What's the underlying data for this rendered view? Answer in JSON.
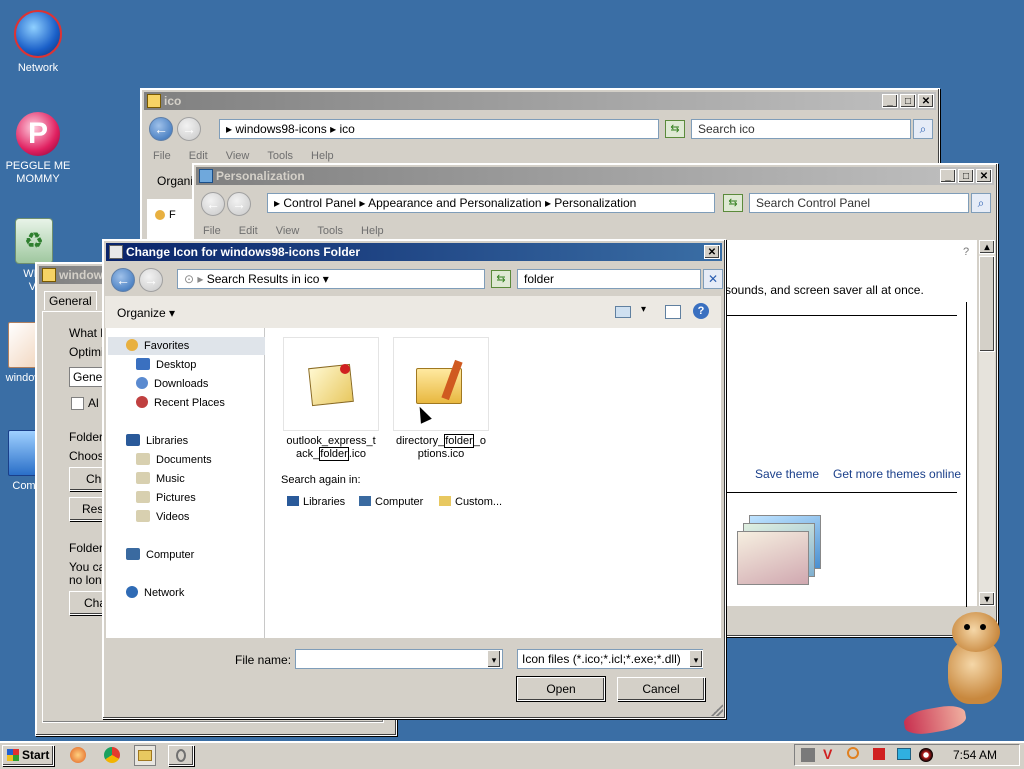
{
  "desktop": {
    "icons": [
      {
        "label": "Network"
      },
      {
        "label": "PEGGLE ME MOMMY"
      },
      {
        "label": "WIN"
      },
      {
        "label": "VI"
      },
      {
        "label": "window"
      },
      {
        "label": "Com"
      }
    ]
  },
  "ico_window": {
    "title": "ico",
    "breadcrumb": [
      "windows98-icons",
      "ico"
    ],
    "search_placeholder": "Search ico",
    "menu": [
      "File",
      "Edit",
      "View",
      "Tools",
      "Help"
    ],
    "organize_partial": "Organi",
    "partial_item": "F"
  },
  "properties_window": {
    "title": "window",
    "tab_general": "General",
    "text_what": "What k",
    "text_optimize": "Optimi",
    "combo_partial": "Gene",
    "check_partial": "Al",
    "group_folder1": "Folder",
    "text_choose": "Choos",
    "btn_ch": "Ch",
    "btn_res": "Res",
    "group_folder2": "Folder",
    "text_you": "You ca",
    "text_nolon": "no lon",
    "btn_cha": "Cha"
  },
  "personalization_window": {
    "title": "Personalization",
    "breadcrumb": [
      "Control Panel",
      "Appearance and Personalization",
      "Personalization"
    ],
    "search_placeholder": "Search Control Panel",
    "menu": [
      "File",
      "Edit",
      "View",
      "Tools",
      "Help"
    ],
    "desc_partial": "sounds, and screen saver all at once.",
    "save_theme": "Save theme",
    "more_themes": "Get more themes online"
  },
  "dialog": {
    "title": "Change Icon for windows98-icons Folder",
    "breadcrumb": "Search Results in ico",
    "search_value": "folder",
    "organize": "Organize",
    "nav": {
      "favorites": "Favorites",
      "favorites_items": [
        "Desktop",
        "Downloads",
        "Recent Places"
      ],
      "libraries": "Libraries",
      "libraries_items": [
        "Documents",
        "Music",
        "Pictures",
        "Videos"
      ],
      "computer": "Computer",
      "network": "Network"
    },
    "files": [
      {
        "name_line1": "outlook_express_t",
        "name_line2_pre": "ack_",
        "name_line2_hl": "folder",
        "name_line2_post": ".ico"
      },
      {
        "name_line1_pre": "directory_",
        "name_line1_hl": "folder",
        "name_line1_post": "_o",
        "name_line2": "ptions.ico"
      }
    ],
    "search_again": "Search again in:",
    "search_again_items": [
      "Libraries",
      "Computer",
      "Custom..."
    ],
    "file_name_label": "File name:",
    "file_name_value": "",
    "file_type": "Icon files (*.ico;*.icl;*.exe;*.dll)",
    "open": "Open",
    "cancel": "Cancel"
  },
  "taskbar": {
    "start": "Start",
    "clock": "7:54 AM"
  }
}
